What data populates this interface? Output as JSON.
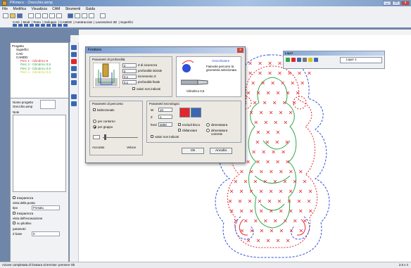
{
  "window": {
    "title": "PKmecc - Orecchio.wrnp"
  },
  "menu": [
    "File",
    "Modifica",
    "Visualizza",
    "CAM",
    "Strumenti",
    "Guida"
  ],
  "mode_tabs": [
    "CAD",
    "Modi",
    "Testo",
    "Sviluppo",
    "CAMDD",
    "Autotracciat",
    "Lavorazioni 3D",
    "Superfici"
  ],
  "tree": {
    "root": "Progetto",
    "nodes": [
      "Superfici",
      "CAD",
      "CAMDD"
    ],
    "paths": [
      "Perc 1 - Cilindrico 6",
      "Perc 2 - Cilindrico 0,5",
      "Perc 3 - Cilindrico 0,9",
      "Perc 4 - Cilindrico 0,5"
    ]
  },
  "props": {
    "name_label": "Nome progetto",
    "name_value": "Orecchio.wrnp",
    "note_label": "Note",
    "trasparenza": "trasparenza",
    "punta_label": "vista della punta",
    "tipo_label": "tipo",
    "tipo_value": "Fresatu",
    "trasparenza2": "trasparenza",
    "scavo_label": "vista dell'escavazione",
    "solo_label": "su pilotlivo",
    "param_label": "parametri",
    "zbase_label": "Z base",
    "zbase_value": "0"
  },
  "layers": {
    "title": "Layer",
    "selected": "Layer 1"
  },
  "dialog": {
    "title": "Foratura",
    "g1_title": "Parametri di profondità",
    "z_sicurezza": "Z di sicurezza",
    "z_sicurezza_val": "2",
    "prof_iniziale": "profondità iniziale",
    "prof_iniziale_val": "0",
    "incremento": "incremento Z",
    "incremento_val": "0,1",
    "prof_finale": "profondità finale",
    "prof_finale_val": "0,1",
    "valori_nc": "valori non indicati",
    "tool_note": "Orecchiatore",
    "tool_hint": "Fatevole percorre la geometria selezionata",
    "tool_name": "Cilindrico 0,5",
    "g2_title": "Parametri di percorso",
    "bidirezionale": "bidirezionale",
    "per_contorno": "per contorno",
    "per_gruppo": "per gruppo",
    "accurato": "Accurato",
    "veloce": "Veloce",
    "g3_title": "Parametri tecnologici",
    "w_label": "W",
    "w_val": "10",
    "z_label": "Z",
    "z_val": "1",
    "feed_label": "feed",
    "feed_val": "3000",
    "escludi": "escludi bisco",
    "dimentatura": "dimentatura",
    "rebalancing": "ribilanciare",
    "dim_corrente": "dimentatura corrente",
    "val_nc2": "valori non indicati",
    "ok": "Ok",
    "annulla": "Annulla"
  },
  "status": {
    "text": "Azione completata di foratura al termine: premere Ok",
    "coord": "2.5 x 4"
  },
  "colors": {
    "desktop": "#6f86a8",
    "path_red": "#e2262b",
    "path_green": "#2fa548",
    "path_blue": "#2e4fd8",
    "accent": "#3b67b1"
  }
}
